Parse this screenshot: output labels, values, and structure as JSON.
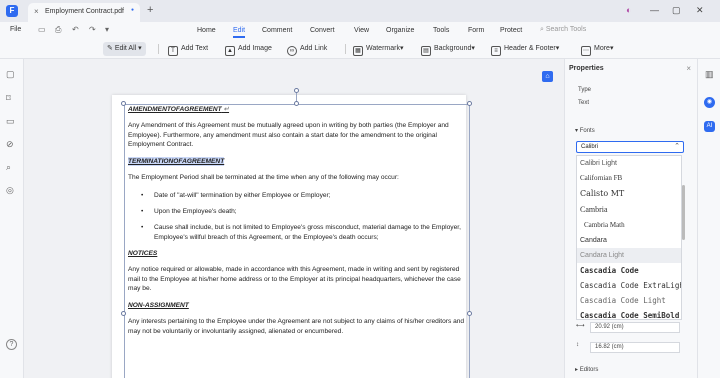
{
  "tabbar": {
    "logo": "F",
    "tab_title": "Employment Contract.pdf",
    "tab_close": "×",
    "tab_pin": "●",
    "new_tab": "+",
    "window_controls": [
      "◐",
      "—",
      "▢",
      "✕"
    ]
  },
  "menubar": {
    "file": "File",
    "quick_icons": [
      "▭",
      "⎙",
      "↶",
      "↷",
      "▾"
    ],
    "items": [
      "Home",
      "Edit",
      "Comment",
      "Convert",
      "View",
      "Organize",
      "Tools",
      "Form",
      "Protect"
    ],
    "active": "Edit",
    "search_placeholder": "Search Tools"
  },
  "toolbar": {
    "edit_all": "Edit All",
    "add_text": "Add Text",
    "add_image": "Add Image",
    "add_link": "Add Link",
    "watermark": "Watermark",
    "background": "Background",
    "header_footer": "Header & Footer",
    "more": "More"
  },
  "left_sidebar": {
    "icons": [
      "▢",
      "⌑",
      "▭",
      "⊘",
      "⌕",
      "◎",
      "?"
    ]
  },
  "document": {
    "h1": "AMENDMENTOFAGREEMENT",
    "p1": "Any Amendment of this Agreement must be mutually agreed upon in writing by both parties (the Employer and Employee).  Furthermore, any amendment must also contain a start date for the amendment to the original Employment Contract.",
    "h2": "TERMINATIONOFAGREEMENT",
    "p2": "The Employment Period shall be terminated at the time when any of the following may occur:",
    "b1": "Date of \"at-will\" termination by either Employee or Employer;",
    "b2": "Upon the Employee's death;",
    "b3": "Cause shall include, but is not limited to Employee's gross misconduct, material damage to the Employer, Employee's willful breach of this Agreement, or the Employee's death occurs;",
    "h3": "NOTICES",
    "p3": "Any notice required or allowable, made in accordance with this Agreement, made in writing and sent by registered mail to the Employee at his/her home address or to the Employer at its principal headquarters, whichever the case may be.",
    "h4": "NON-ASSIGNMENT",
    "p4": "Any interests pertaining to the Employee under the Agreement are not subject to any claims of his/her creditors and may not be voluntarily or involuntarily assigned, alienated or encumbered.",
    "para_mark": "↵"
  },
  "properties": {
    "title": "Properties",
    "close": "×",
    "type_label": "Type",
    "type_value": "Text",
    "fonts_section": "Fonts",
    "font_value": "Calibri",
    "font_options": [
      "Calibri Light",
      "Californian FB",
      "Calisto MT",
      "Cambria",
      "Cambria Math",
      "Candara",
      "Candara Light",
      "Cascadia Code",
      "Cascadia Code ExtraLight",
      "Cascadia Code Light",
      "Cascadia Code SemiBold"
    ],
    "highlighted_option": "Candara Light",
    "width_value": "20.92 (cm)",
    "height_value": "16.82 (cm)",
    "bottom_section": "Editors"
  },
  "right_rail": {
    "icons": [
      "▥",
      "◉",
      "AI"
    ]
  }
}
